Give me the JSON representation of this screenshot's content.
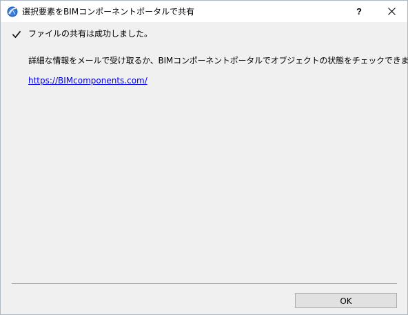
{
  "window": {
    "title": "選択要素をBIMコンポーネントポータルで共有",
    "help_label": "?",
    "close_icon": "close-icon",
    "app_icon": "archicad-icon"
  },
  "content": {
    "status_icon": "check-icon",
    "status_message": "ファイルの共有は成功しました。",
    "info_message": "詳細な情報をメールで受け取るか、BIMコンポーネントポータルでオブジェクトの状態をチェックできます:",
    "link_text": "https://BIMcomponents.com/"
  },
  "footer": {
    "ok_label": "OK"
  },
  "colors": {
    "link": "#0000ee",
    "app_icon_blue": "#1f5fbf",
    "dialog_background": "#f0f0f0",
    "titlebar_background": "#ffffff"
  }
}
